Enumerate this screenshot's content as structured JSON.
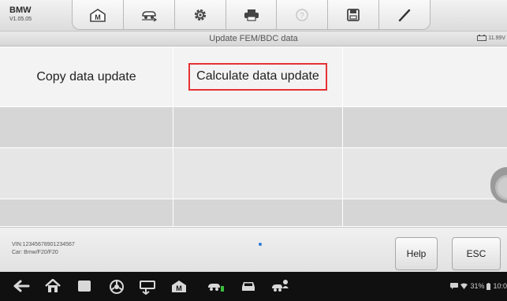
{
  "app": {
    "brand": "BMW",
    "version": "V1.05.05"
  },
  "toolbar": {
    "tools": [
      {
        "icon": "home-icon"
      },
      {
        "icon": "vehicle-swap-icon"
      },
      {
        "icon": "settings-gear-icon"
      },
      {
        "icon": "printer-icon"
      },
      {
        "icon": "help-circle-icon"
      },
      {
        "icon": "save-icon"
      },
      {
        "icon": "pen-icon"
      }
    ]
  },
  "titlebar": {
    "title": "Update FEM/BDC data",
    "battery_voltage": "11.99V"
  },
  "grid": {
    "rows": [
      [
        "Copy data update",
        "Calculate data update",
        ""
      ],
      [
        "",
        "",
        ""
      ],
      [
        "",
        "",
        ""
      ],
      [
        "",
        "",
        ""
      ]
    ],
    "highlight_color": "#e53232"
  },
  "footer": {
    "vin": "VIN:12345678901234567",
    "car": "Car: Bmw/F20/F20",
    "help_label": "Help",
    "esc_label": "ESC"
  },
  "navbar": {
    "battery_percent": "31%",
    "clock": "10:0"
  }
}
